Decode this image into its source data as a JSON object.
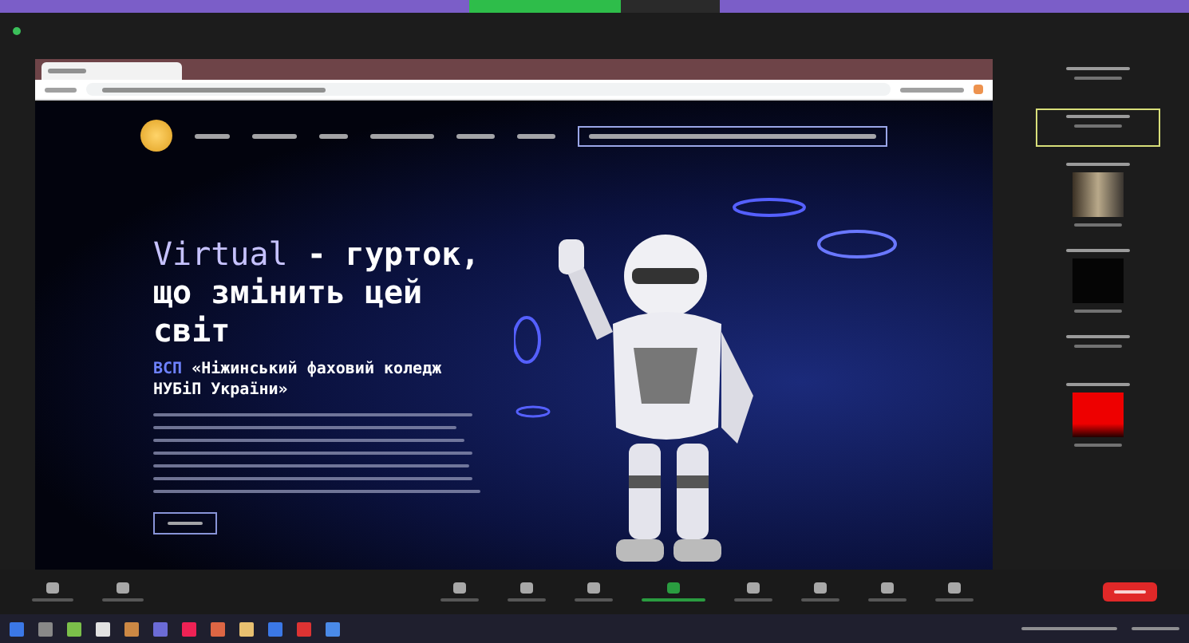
{
  "hero": {
    "headline_highlight": "Virtual",
    "headline_rest": " - гурток, що змінить цей світ",
    "subtitle_highlight": "ВСП",
    "subtitle_rest": " «Ніжинський фаховий коледж НУБіП України»"
  },
  "participants": [
    {
      "kind": "none",
      "highlighted": false
    },
    {
      "kind": "none",
      "highlighted": true
    },
    {
      "kind": "photo",
      "highlighted": false
    },
    {
      "kind": "black",
      "highlighted": false
    },
    {
      "kind": "none",
      "highlighted": false
    },
    {
      "kind": "red",
      "highlighted": false
    }
  ]
}
